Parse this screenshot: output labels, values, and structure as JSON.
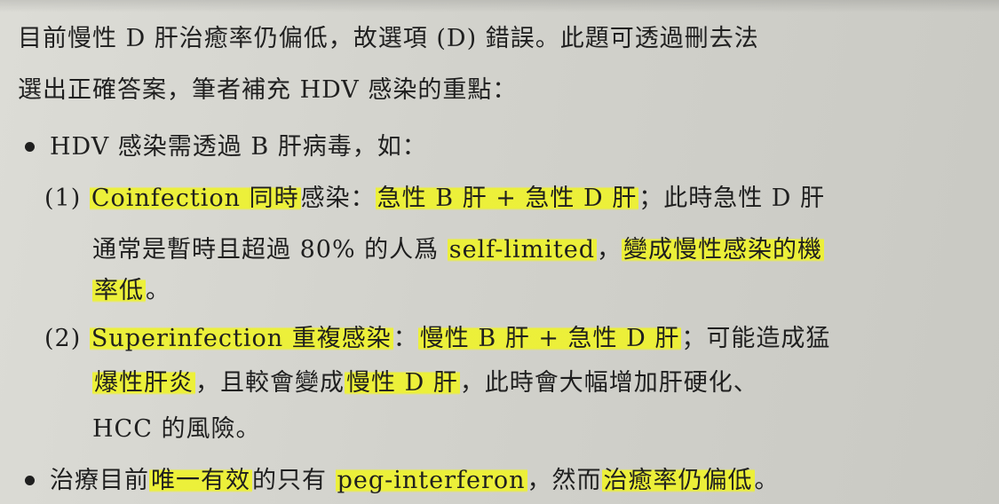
{
  "paragraph": {
    "line1": "目前慢性 D 肝治癒率仍偏低，故選項 (D) 錯誤。此題可透過刪去法",
    "line2": "選出正確答案，筆者補充 HDV 感染的重點："
  },
  "bullet1": {
    "text": "HDV 感染需透過 B 肝病毒，如："
  },
  "item1": {
    "number": "(1)",
    "term": "Coinfection",
    "term_zh": "同時",
    "term_zh_rest": "感染：",
    "hl_phrase": "急性 B 肝 + 急性 D 肝",
    "after_phrase": "；此時急性 D 肝",
    "line2_pre": "通常是暫時且超過 80% 的人爲",
    "line2_hl": "self-limited",
    "line2_mid": "，",
    "line2_hl2": "變成慢性感染的機",
    "line3_hl": "率低",
    "line3_post": "。"
  },
  "item2": {
    "number": "(2)",
    "term": "Superinfection",
    "term_zh": "重複感染",
    "colon": "：",
    "hl_phrase": "慢性 B 肝 + 急性 D 肝",
    "after_phrase": "；可能造成猛",
    "line2_hl": "爆性肝炎",
    "line2_mid": "，且較會變成",
    "line2_hl2": "慢性 D 肝",
    "line2_post": "，此時會大幅增加肝硬化、",
    "line3": "HCC 的風險。"
  },
  "bullet2": {
    "pre": "治療目前",
    "hl1": "唯一有效",
    "mid1": "的只有",
    "hl2": "peg-interferon",
    "mid2": "，然而",
    "hl3": "治癒率仍偏低",
    "post": "。"
  },
  "colors": {
    "highlight": "#eef22d",
    "paper": "#d2d2cc",
    "ink": "#1f1f1f"
  }
}
